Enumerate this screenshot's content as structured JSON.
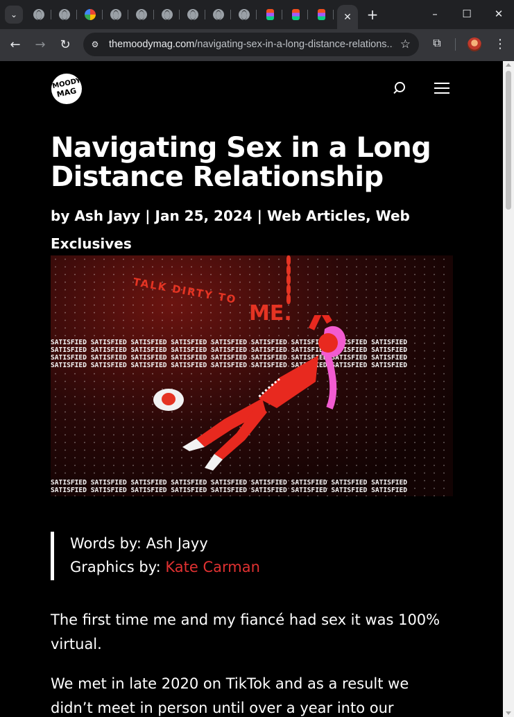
{
  "browser": {
    "tab_menu_icon": "chevron-down-icon",
    "tabs": [
      {
        "favicon": "globe-icon"
      },
      {
        "favicon": "globe-icon"
      },
      {
        "favicon": "google-icon"
      },
      {
        "favicon": "globe-icon"
      },
      {
        "favicon": "globe-icon"
      },
      {
        "favicon": "globe-icon"
      },
      {
        "favicon": "globe-icon"
      },
      {
        "favicon": "globe-icon"
      },
      {
        "favicon": "globe-icon"
      },
      {
        "favicon": "figma-icon"
      },
      {
        "favicon": "figma-icon"
      },
      {
        "favicon": "figma-icon"
      }
    ],
    "active_tab_close": "✕",
    "new_tab": "+",
    "window_buttons": {
      "minimize": "–",
      "maximize": "☐",
      "close": "✕"
    },
    "nav": {
      "back": "←",
      "forward": "→",
      "reload": "↻"
    },
    "url_host": "themoodymag.com",
    "url_path": "/navigating-sex-in-a-long-distance-relations...",
    "bookmark_star": "☆",
    "extensions_icon": "puzzle-icon",
    "menu": "⋮"
  },
  "site": {
    "logo_line1": "MOODY",
    "logo_line2": "MAG"
  },
  "article": {
    "title": "Navigating Sex in a Long Distance Relationship",
    "meta": "by Ash Jayy | Jan 25, 2024 | Web Articles, Web Exclusives",
    "hero": {
      "caption_talk": "TALK DIRTY TO",
      "caption_me": "ME.",
      "satisfied_row": "SATISFIED SATISFIED SATISFIED SATISFIED SATISFIED SATISFIED SATISFIED SATISFIED SATISFIED"
    },
    "credits": {
      "words_label": "Words by: Ash Jayy",
      "graphics_label": "Graphics by: ",
      "graphics_name": "Kate Carman"
    },
    "paragraphs": [
      "The first time me and my fiancé had sex it was 100% virtual.",
      "We met in late 2020 on TikTok and as a result we didn’t meet in person until over a year into our"
    ]
  },
  "colors": {
    "link": "#e03131",
    "accent_red": "#e53423"
  }
}
